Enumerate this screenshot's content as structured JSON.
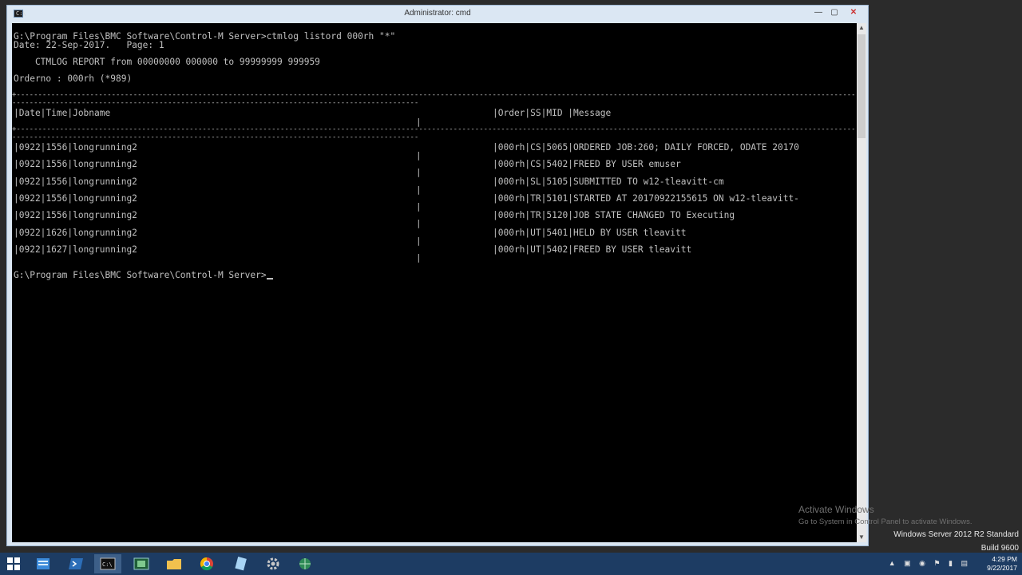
{
  "window": {
    "title": "Administrator: cmd",
    "icon_text": "C:\\",
    "min_label": "—",
    "max_label": "▢",
    "close_label": "✕"
  },
  "console": {
    "command_line": "G:\\Program Files\\BMC Software\\Control-M Server>ctmlog listord 000rh \"*\"",
    "date_line": "Date: 22-Sep-2017.   Page: 1",
    "report_line": "    CTMLOG REPORT from 00000000 000000 to 99999999 999959",
    "orderno_line": "Orderno : 000rh (*989)",
    "header_left": "|Date|Time|Jobname",
    "header_right": "|Order|SS|MID |Message",
    "rows": [
      {
        "left": "|0922|1556|longrunning2",
        "right": "|000rh|CS|5065|ORDERED JOB:260; DAILY FORCED, ODATE 20170"
      },
      {
        "left": "|0922|1556|longrunning2",
        "right": "|000rh|CS|5402|FREED BY USER emuser"
      },
      {
        "left": "|0922|1556|longrunning2",
        "right": "|000rh|SL|5105|SUBMITTED TO w12-tleavitt-cm"
      },
      {
        "left": "|0922|1556|longrunning2",
        "right": "|000rh|TR|5101|STARTED AT 20170922155615 ON w12-tleavitt-"
      },
      {
        "left": "|0922|1556|longrunning2",
        "right": "|000rh|TR|5120|JOB STATE CHANGED TO Executing"
      },
      {
        "left": "|0922|1626|longrunning2",
        "right": "|000rh|UT|5401|HELD BY USER tleavitt"
      },
      {
        "left": "|0922|1627|longrunning2",
        "right": "|000rh|UT|5402|FREED BY USER tleavitt"
      }
    ],
    "prompt": "G:\\Program Files\\BMC Software\\Control-M Server>"
  },
  "watermark": {
    "line1": "Activate Windows",
    "line2": "Go to System in Control Panel to activate Windows."
  },
  "os_info": {
    "line1": "Windows Server 2012 R2 Standard",
    "line2": "Build 9600"
  },
  "taskbar": {
    "items": [
      "windows-start-icon",
      "server-manager-icon",
      "powershell-icon",
      "cmd-icon",
      "control-m-icon",
      "file-explorer-icon",
      "chrome-icon",
      "notepad-icon",
      "settings-icon",
      "network-icon"
    ],
    "tray_icons": "▲ ▣ ◉ ⚑ ▮ ▤",
    "time": "4:29 PM",
    "date": "9/22/2017"
  }
}
